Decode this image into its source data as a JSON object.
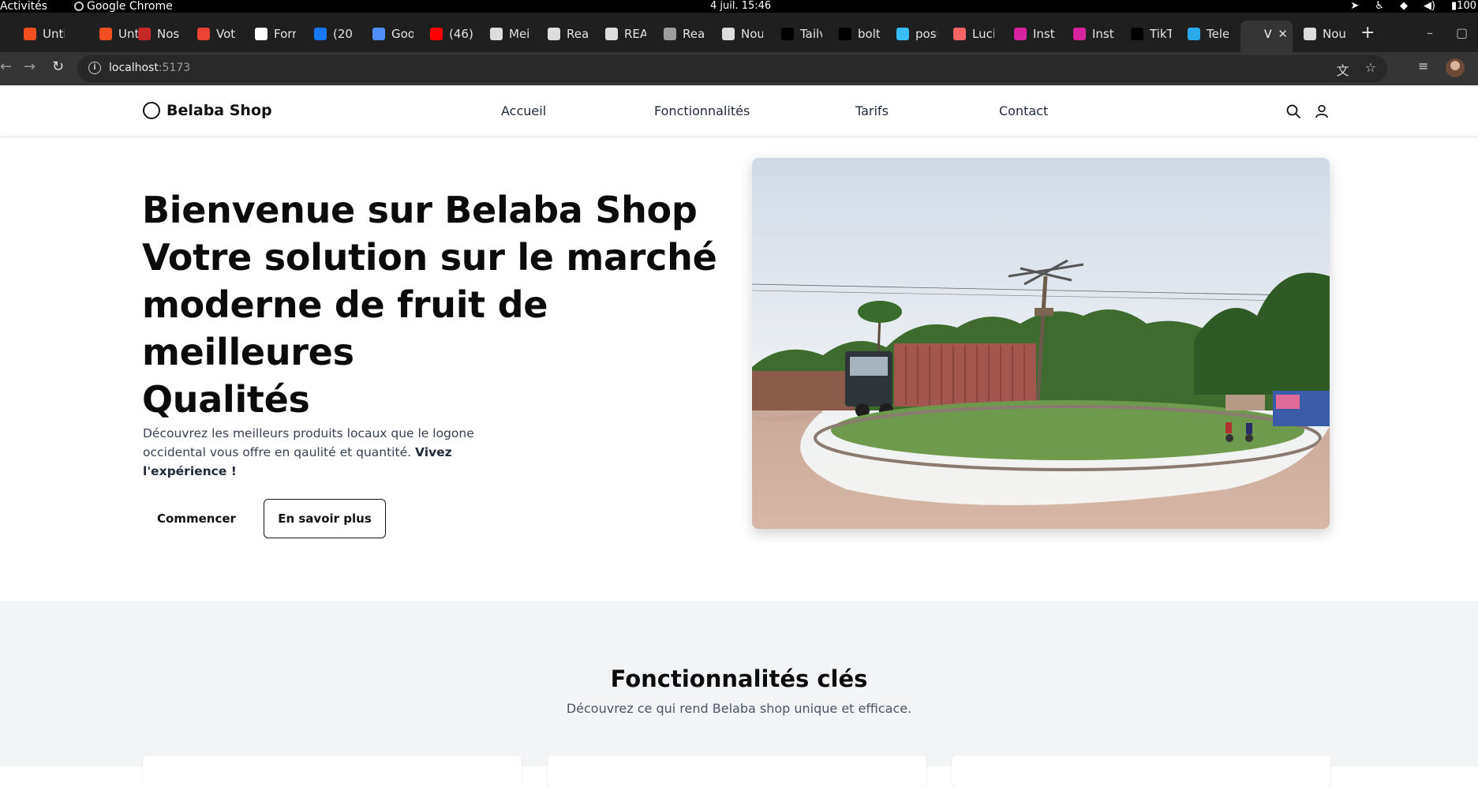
{
  "os": {
    "activities": "Activités",
    "app_name": "Google Chrome",
    "clock": "4 juil.  15:46",
    "battery": "100"
  },
  "browser": {
    "tabs": [
      {
        "label": "Unti",
        "icon": "figma-icon",
        "color": "#f24e1e"
      },
      {
        "label": "Unti",
        "icon": "figma-icon",
        "color": "#f24e1e"
      },
      {
        "label": "Nos",
        "icon": "bookmark-icon",
        "color": "#c62828"
      },
      {
        "label": "Vot",
        "icon": "gmail-icon",
        "color": "#ea4335"
      },
      {
        "label": "Forr",
        "icon": "c-logo-icon",
        "color": "#ffffff"
      },
      {
        "label": "(20",
        "icon": "facebook-icon",
        "color": "#1877f2"
      },
      {
        "label": "Goo",
        "icon": "gemini-icon",
        "color": "#4f8ef7"
      },
      {
        "label": "(46)",
        "icon": "youtube-icon",
        "color": "#ff0000"
      },
      {
        "label": "Mei",
        "icon": "leaf-icon",
        "color": "#dddddd"
      },
      {
        "label": "Rea",
        "icon": "globe-icon",
        "color": "#dddddd"
      },
      {
        "label": "REA",
        "icon": "globe-icon",
        "color": "#dddddd"
      },
      {
        "label": "Rea",
        "icon": "globe-icon",
        "color": "#9e9e9e"
      },
      {
        "label": "Nou",
        "icon": "chrome-icon",
        "color": "#dddddd"
      },
      {
        "label": "Tailv",
        "icon": "m-logo-icon",
        "color": "#000000"
      },
      {
        "label": "bolt",
        "icon": "bolt-icon",
        "color": "#000000"
      },
      {
        "label": "posi",
        "icon": "tailwind-icon",
        "color": "#38bdf8"
      },
      {
        "label": "Luci",
        "icon": "lucide-icon",
        "color": "#f56565"
      },
      {
        "label": "Inst",
        "icon": "instagram-icon",
        "color": "#d6249f"
      },
      {
        "label": "Inst",
        "icon": "instagram-icon",
        "color": "#d6249f"
      },
      {
        "label": "TikT",
        "icon": "tiktok-icon",
        "color": "#000000"
      },
      {
        "label": "Tele",
        "icon": "telegram-icon",
        "color": "#29a9eb"
      },
      {
        "label": "V",
        "icon": "vite-icon",
        "color": "#a855f7"
      },
      {
        "label": "Nou",
        "icon": "chrome-icon",
        "color": "#dddddd"
      }
    ],
    "url_host": "localhost",
    "url_port": ":5173"
  },
  "site": {
    "brand": "Belaba Shop",
    "nav": [
      "Accueil",
      "Fonctionnalités",
      "Tarifs",
      "Contact"
    ],
    "hero": {
      "title_lines": [
        "Bienvenue sur Belaba Shop",
        "Votre solution sur le marché",
        "moderne de fruit de meilleures",
        "Qualités"
      ],
      "description": "Découvrez les meilleurs produits locaux que le logone occidental vous offre en qaulité et quantité.",
      "description_bold": "Vivez l'expérience !",
      "btn_primary": "Commencer",
      "btn_secondary": "En savoir plus"
    },
    "features": {
      "title": "Fonctionnalités clés",
      "subtitle": "Découvrez ce qui rend Belaba shop unique et efficace."
    }
  },
  "colors": {
    "text_dark": "#0b0b0b",
    "nav_text": "#1f2937",
    "muted": "#4b5563",
    "section_bg": "#f3f4f6"
  }
}
